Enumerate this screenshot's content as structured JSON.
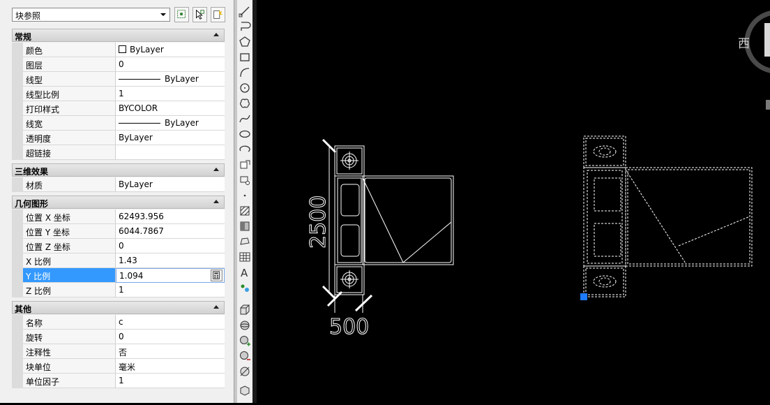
{
  "selector": {
    "value": "块参照"
  },
  "sections": {
    "general": "常规",
    "three_d": "三维效果",
    "geometry": "几何图形",
    "misc": "其他"
  },
  "general": [
    {
      "name": "颜色",
      "value": "ByLayer"
    },
    {
      "name": "图层",
      "value": "0"
    },
    {
      "name": "线型",
      "value": "ByLayer"
    },
    {
      "name": "线型比例",
      "value": "1"
    },
    {
      "name": "打印样式",
      "value": "BYCOLOR"
    },
    {
      "name": "线宽",
      "value": "ByLayer"
    },
    {
      "name": "透明度",
      "value": "ByLayer"
    },
    {
      "name": "超链接",
      "value": ""
    }
  ],
  "three_d": [
    {
      "name": "材质",
      "value": "ByLayer"
    }
  ],
  "geometry": [
    {
      "name": "位置 X 坐标",
      "value": "62493.956"
    },
    {
      "name": "位置 Y 坐标",
      "value": "6044.7867"
    },
    {
      "name": "位置 Z 坐标",
      "value": "0"
    },
    {
      "name": "X 比例",
      "value": "1.43"
    },
    {
      "name": "Y 比例",
      "value": "1.094"
    },
    {
      "name": "Z 比例",
      "value": "1"
    }
  ],
  "misc": [
    {
      "name": "名称",
      "value": "c"
    },
    {
      "name": "旋转",
      "value": "0"
    },
    {
      "name": "注释性",
      "value": "否"
    },
    {
      "name": "块单位",
      "value": "毫米"
    },
    {
      "name": "单位因子",
      "value": "1"
    }
  ],
  "drawing": {
    "dim_vertical": "2500",
    "dim_horizontal": "500",
    "compass_label": "西"
  },
  "colors": {
    "selection": "#3399ff",
    "grip": "#1e7bff",
    "canvas": "#000000"
  }
}
